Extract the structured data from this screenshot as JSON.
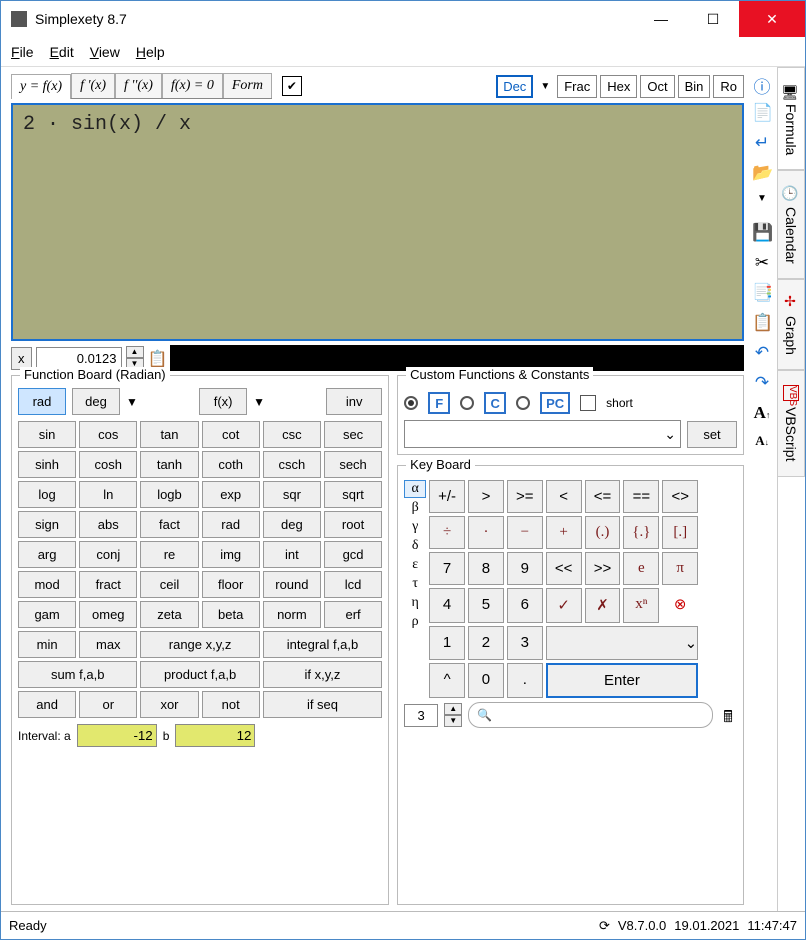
{
  "window": {
    "title": "Simplexety 8.7"
  },
  "menu": {
    "file": "File",
    "edit": "Edit",
    "view": "View",
    "help": "Help"
  },
  "tabs": {
    "yfx": "y = f(x)",
    "fp": "f '(x)",
    "fpp": "f ''(x)",
    "fz": "f(x) = 0",
    "form": "Form"
  },
  "formats": {
    "dec": "Dec",
    "frac": "Frac",
    "hex": "Hex",
    "oct": "Oct",
    "bin": "Bin",
    "ro": "Ro"
  },
  "editor": {
    "content": "2 · sin(x) / x"
  },
  "xbox": {
    "label": "x",
    "value": "0.0123"
  },
  "vtabs": {
    "formula": "Formula",
    "calendar": "Calendar",
    "graph": "Graph",
    "vbscript": "VBScript"
  },
  "fnboard": {
    "title": "Function Board (Radian)",
    "mode_rad": "rad",
    "mode_deg": "deg",
    "fx": "f(x)",
    "inv": "inv",
    "rows": [
      [
        "sin",
        "cos",
        "tan",
        "cot",
        "csc",
        "sec"
      ],
      [
        "sinh",
        "cosh",
        "tanh",
        "coth",
        "csch",
        "sech"
      ],
      [
        "log",
        "ln",
        "logb",
        "exp",
        "sqr",
        "sqrt"
      ],
      [
        "sign",
        "abs",
        "fact",
        "rad",
        "deg",
        "root"
      ],
      [
        "arg",
        "conj",
        "re",
        "img",
        "int",
        "gcd"
      ],
      [
        "mod",
        "fract",
        "ceil",
        "floor",
        "round",
        "lcd"
      ],
      [
        "gam",
        "omeg",
        "zeta",
        "beta",
        "norm",
        "erf"
      ]
    ],
    "wide": {
      "min": "min",
      "max": "max",
      "range": "range x,y,z",
      "integral": "integral f,a,b",
      "sumf": "sum f,a,b",
      "prodf": "product f,a,b",
      "ifxyz": "if x,y,z",
      "and": "and",
      "or": "or",
      "xor": "xor",
      "not": "not",
      "ifseq": "if seq"
    },
    "interval": {
      "label_a": "Interval: a",
      "a": "-12",
      "label_b": "b",
      "b": "12"
    }
  },
  "custom": {
    "title": "Custom Functions & Constants",
    "F": "F",
    "C": "C",
    "PC": "PC",
    "short": "short",
    "set": "set"
  },
  "keyboard": {
    "title": "Key Board",
    "greek": [
      "α",
      "β",
      "γ",
      "δ",
      "ε",
      "τ",
      "η",
      "ρ"
    ],
    "r1": [
      "+/-",
      ">",
      ">=",
      "<",
      "<=",
      "==",
      "<>"
    ],
    "r2": [
      "÷",
      "·",
      "−",
      "+",
      "(.)",
      "{.}",
      "[.]"
    ],
    "r3": [
      "7",
      "8",
      "9",
      "<<",
      ">>",
      "e",
      "π"
    ],
    "r4": [
      "4",
      "5",
      "6",
      "✓",
      "✗",
      "xⁿ",
      "✖"
    ],
    "r5_nums": [
      "1",
      "2",
      "3"
    ],
    "r6": {
      "caret": "^",
      "zero": "0",
      "dot": ".",
      "enter": "Enter"
    },
    "foot_num": "3"
  },
  "status": {
    "ready": "Ready",
    "version": "V8.7.0.0",
    "date": "19.01.2021",
    "time": "11:47:47"
  }
}
